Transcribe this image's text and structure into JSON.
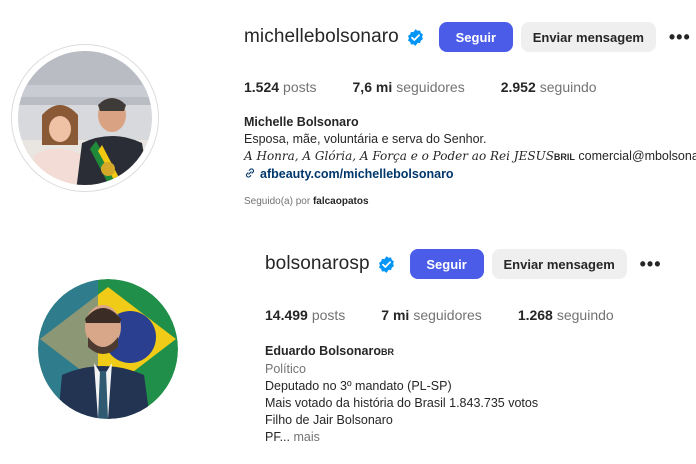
{
  "profile1": {
    "username": "michellebolsonaro",
    "follow_label": "Seguir",
    "message_label": "Enviar mensagem",
    "more_label": "•••",
    "stats": [
      {
        "num": "1.524",
        "label": "posts"
      },
      {
        "num": "7,6 mi",
        "label": "seguidores"
      },
      {
        "num": "2.952",
        "label": "seguindo"
      }
    ],
    "bio_name": "Michelle Bolsonaro",
    "bio_line1": "Esposa, mãe, voluntária e serva do Senhor.",
    "bio_line2_italic": "A Honra, A Glória, A Força e o Poder ao Rei JESUS",
    "bio_line2_tag": "BRIL",
    "bio_line2_rest": " comercial@mbolsonaro",
    "link": "afbeauty.com/michellebolsonaro",
    "followed_prefix": "Seguido(a) por ",
    "followed_by": "falcaopatos"
  },
  "profile2": {
    "username": "bolsonarosp",
    "follow_label": "Seguir",
    "message_label": "Enviar mensagem",
    "more_label": "•••",
    "stats": [
      {
        "num": "14.499",
        "label": "posts"
      },
      {
        "num": "7 mi",
        "label": "seguidores"
      },
      {
        "num": "1.268",
        "label": "seguindo"
      }
    ],
    "bio_name": "Eduardo Bolsonaro",
    "bio_name_tag": "BR",
    "category": "Político",
    "bio_lines": [
      "Deputado no 3º mandato (PL-SP)",
      "Mais votado da história do Brasil 1.843.735 votos",
      "Filho de Jair Bolsonaro"
    ],
    "bio_trunc": "PF...",
    "more_text": "mais"
  },
  "colors": {
    "follow_button": "#4a5ce8",
    "verified_badge": "#0095f6",
    "link": "#00376b"
  }
}
